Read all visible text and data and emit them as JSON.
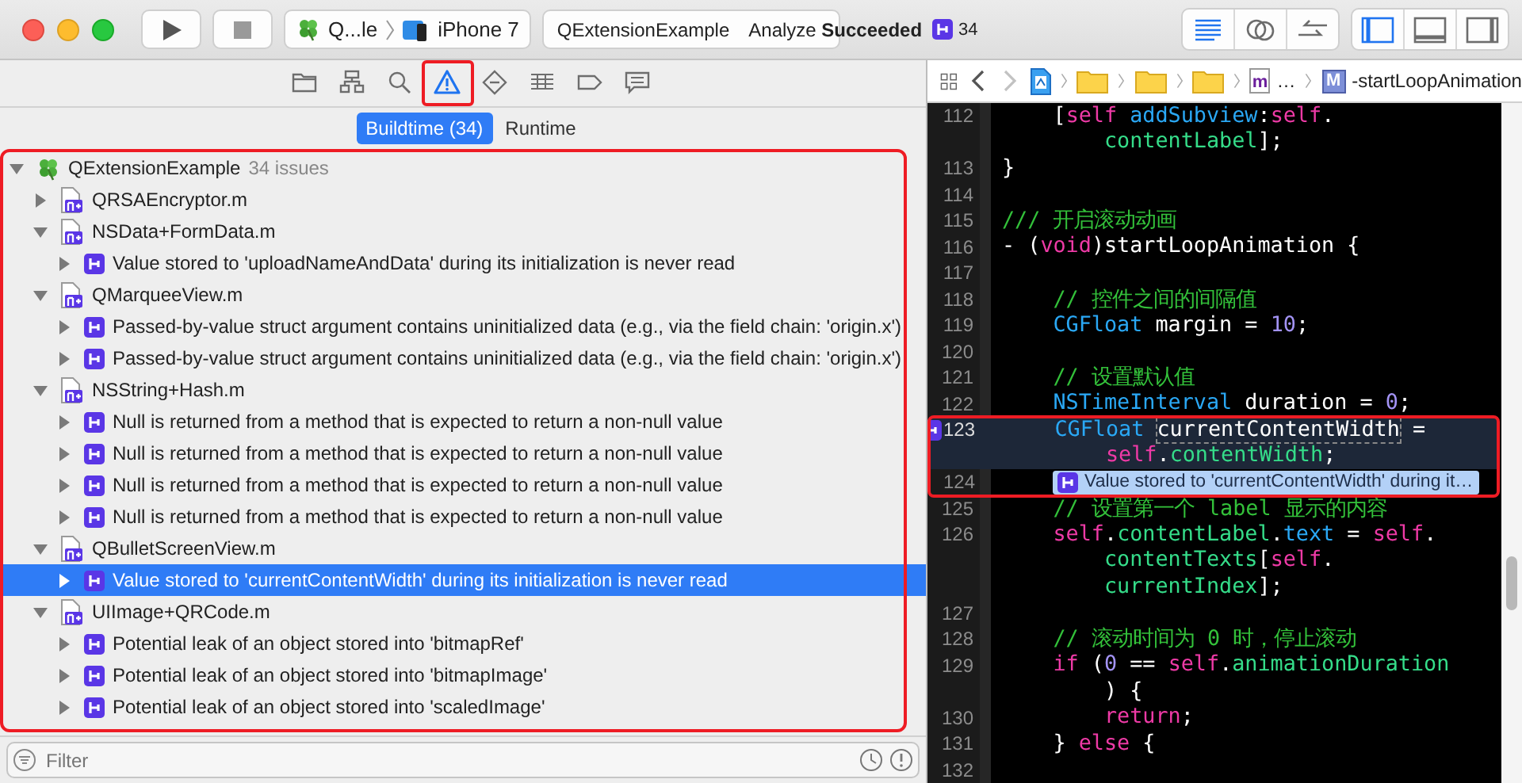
{
  "window": {
    "traffic_lights": [
      {
        "kind": "close"
      },
      {
        "kind": "minimize"
      },
      {
        "kind": "zoom"
      }
    ]
  },
  "toolbar": {
    "run_buttons": [
      {
        "kind": "run"
      },
      {
        "kind": "stop"
      }
    ],
    "scheme": {
      "project": "Q...le",
      "device": "iPhone 7"
    },
    "activity": {
      "project": "QExtensionExample",
      "status": "Analyze **Succeeded**",
      "issue_count": "34"
    },
    "editor_modes": [
      {
        "kind": "standard",
        "selected": true
      },
      {
        "kind": "assistant",
        "selected": false
      },
      {
        "kind": "version",
        "selected": false
      }
    ],
    "panels": [
      {
        "kind": "navigator",
        "on": true
      },
      {
        "kind": "debug",
        "on": false
      },
      {
        "kind": "utilities",
        "on": false
      }
    ]
  },
  "navigator": {
    "tabs": [
      {
        "kind": "folder",
        "selected": false
      },
      {
        "kind": "hierarchy",
        "selected": false
      },
      {
        "kind": "search",
        "selected": false
      },
      {
        "kind": "warning",
        "selected": true,
        "framed": true
      },
      {
        "kind": "test",
        "selected": false
      },
      {
        "kind": "debug",
        "selected": false
      },
      {
        "kind": "breakpoint",
        "selected": false
      },
      {
        "kind": "report",
        "selected": false
      }
    ],
    "segments": [
      {
        "label": "Buildtime (34)",
        "selected": true
      },
      {
        "label": "Runtime",
        "selected": false
      }
    ],
    "issue_tree": {
      "framed": true,
      "children": [
        {
          "kind": "project",
          "label": "QExtensionExample",
          "count": "34 issues",
          "expanded": true,
          "selected": false,
          "children": [
            {
              "kind": "file",
              "label": "QRSAEncryptor.m",
              "expanded": false,
              "selected": false
            },
            {
              "kind": "file",
              "label": "NSData+FormData.m",
              "expanded": true,
              "selected": false,
              "children": [
                {
                  "kind": "issue",
                  "label": "Value stored to 'uploadNameAndData' during its initialization is never read",
                  "expanded": false,
                  "selected": false
                }
              ]
            },
            {
              "kind": "file",
              "label": "QMarqueeView.m",
              "expanded": true,
              "selected": false,
              "children": [
                {
                  "kind": "issue",
                  "label": "Passed-by-value struct argument contains uninitialized data (e.g., via the field chain: 'origin.x')",
                  "expanded": false,
                  "selected": false
                },
                {
                  "kind": "issue",
                  "label": "Passed-by-value struct argument contains uninitialized data (e.g., via the field chain: 'origin.x')",
                  "expanded": false,
                  "selected": false
                }
              ]
            },
            {
              "kind": "file",
              "label": "NSString+Hash.m",
              "expanded": true,
              "selected": false,
              "children": [
                {
                  "kind": "issue",
                  "label": "Null is returned from a method that is expected to return a non-null value",
                  "expanded": false,
                  "selected": false
                },
                {
                  "kind": "issue",
                  "label": "Null is returned from a method that is expected to return a non-null value",
                  "expanded": false,
                  "selected": false
                },
                {
                  "kind": "issue",
                  "label": "Null is returned from a method that is expected to return a non-null value",
                  "expanded": false,
                  "selected": false
                },
                {
                  "kind": "issue",
                  "label": "Null is returned from a method that is expected to return a non-null value",
                  "expanded": false,
                  "selected": false
                }
              ]
            },
            {
              "kind": "file",
              "label": "QBulletScreenView.m",
              "expanded": true,
              "selected": false,
              "children": [
                {
                  "kind": "issue",
                  "label": "Value stored to 'currentContentWidth' during its initialization is never read",
                  "expanded": false,
                  "selected": true
                }
              ]
            },
            {
              "kind": "file",
              "label": "UIImage+QRCode.m",
              "expanded": true,
              "selected": false,
              "children": [
                {
                  "kind": "issue",
                  "label": "Potential leak of an object stored into 'bitmapRef'",
                  "expanded": false,
                  "selected": false
                },
                {
                  "kind": "issue",
                  "label": "Potential leak of an object stored into 'bitmapImage'",
                  "expanded": false,
                  "selected": false
                },
                {
                  "kind": "issue",
                  "label": "Potential leak of an object stored into 'scaledImage'",
                  "expanded": false,
                  "selected": false
                }
              ]
            }
          ]
        }
      ]
    },
    "filter": {
      "placeholder": "Filter"
    }
  },
  "editor": {
    "nav_buttons": [
      {
        "kind": "back",
        "disabled": false
      },
      {
        "kind": "forward",
        "disabled": true
      }
    ],
    "breadcrumb": [
      {
        "kind": "project"
      },
      {
        "kind": "folder"
      },
      {
        "kind": "folder"
      },
      {
        "kind": "folder"
      },
      {
        "kind": "source",
        "badge": "m",
        "label": "…"
      },
      {
        "kind": "method",
        "badge": "M",
        "label": "-startLoopAnimation"
      }
    ],
    "lines": [
      {
        "number": "112",
        "segments": [
          {
            "kind": "plain",
            "text": "    ["
          },
          {
            "kind": "keyword",
            "text": "self"
          },
          {
            "kind": "type",
            "text": " addSubview"
          },
          {
            "kind": "plain",
            "text": ":"
          },
          {
            "kind": "keyword",
            "text": "self"
          },
          {
            "kind": "plain",
            "text": "."
          }
        ]
      },
      {
        "segments": [
          {
            "kind": "ident",
            "text": "        contentLabel"
          },
          {
            "kind": "plain",
            "text": "];"
          }
        ]
      },
      {
        "number": "113",
        "segments": [
          {
            "kind": "plain",
            "text": "}"
          }
        ]
      },
      {
        "number": "114"
      },
      {
        "number": "115",
        "segments": [
          {
            "kind": "comment",
            "text": "/// 开启滚动动画"
          }
        ]
      },
      {
        "number": "116",
        "segments": [
          {
            "kind": "plain",
            "text": "- ("
          },
          {
            "kind": "keyword",
            "text": "void"
          },
          {
            "kind": "plain",
            "text": ")startLoopAnimation {"
          }
        ]
      },
      {
        "number": "117"
      },
      {
        "number": "118",
        "segments": [
          {
            "kind": "comment",
            "text": "    // 控件之间的间隔值"
          }
        ]
      },
      {
        "number": "119",
        "segments": [
          {
            "kind": "type",
            "text": "    CGFloat"
          },
          {
            "kind": "plain",
            "text": " margin = "
          },
          {
            "kind": "number",
            "text": "10"
          },
          {
            "kind": "plain",
            "text": ";"
          }
        ]
      },
      {
        "number": "120"
      },
      {
        "number": "121",
        "segments": [
          {
            "kind": "comment",
            "text": "    // 设置默认值"
          }
        ]
      },
      {
        "number": "122",
        "segments": [
          {
            "kind": "type",
            "text": "    NSTimeInterval"
          },
          {
            "kind": "plain",
            "text": " duration = "
          },
          {
            "kind": "number",
            "text": "0"
          },
          {
            "kind": "plain",
            "text": ";"
          }
        ]
      },
      {
        "number": "123",
        "issue": true,
        "highlighted": true,
        "framed": true,
        "segments": [
          {
            "kind": "type",
            "text": "    CGFloat "
          },
          {
            "kind": "flagged",
            "text": "currentContentWidth"
          },
          {
            "kind": "plain",
            "text": " ="
          }
        ]
      },
      {
        "highlighted": true,
        "framed": true,
        "segments": [
          {
            "kind": "keyword",
            "text": "        self"
          },
          {
            "kind": "plain",
            "text": "."
          },
          {
            "kind": "ident",
            "text": "contentWidth"
          },
          {
            "kind": "plain",
            "text": ";"
          }
        ]
      },
      {
        "number": "124",
        "framed": true,
        "annotation": "Value stored to 'currentContentWidth' during it…"
      },
      {
        "number": "125",
        "segments": [
          {
            "kind": "comment",
            "text": "    // 设置第一个 label 显示的内容"
          }
        ]
      },
      {
        "number": "126",
        "segments": [
          {
            "kind": "keyword",
            "text": "    self"
          },
          {
            "kind": "plain",
            "text": "."
          },
          {
            "kind": "ident",
            "text": "contentLabel"
          },
          {
            "kind": "plain",
            "text": "."
          },
          {
            "kind": "type",
            "text": "text"
          },
          {
            "kind": "plain",
            "text": " = "
          },
          {
            "kind": "keyword",
            "text": "self"
          },
          {
            "kind": "plain",
            "text": "."
          }
        ]
      },
      {
        "segments": [
          {
            "kind": "ident",
            "text": "        contentTexts"
          },
          {
            "kind": "plain",
            "text": "["
          },
          {
            "kind": "keyword",
            "text": "self"
          },
          {
            "kind": "plain",
            "text": "."
          }
        ]
      },
      {
        "segments": [
          {
            "kind": "ident",
            "text": "        currentIndex"
          },
          {
            "kind": "plain",
            "text": "];"
          }
        ]
      },
      {
        "number": "127"
      },
      {
        "number": "128",
        "segments": [
          {
            "kind": "comment",
            "text": "    // 滚动时间为 0 时，停止滚动"
          }
        ]
      },
      {
        "number": "129",
        "segments": [
          {
            "kind": "keyword",
            "text": "    if"
          },
          {
            "kind": "plain",
            "text": " ("
          },
          {
            "kind": "number",
            "text": "0"
          },
          {
            "kind": "plain",
            "text": " == "
          },
          {
            "kind": "keyword",
            "text": "self"
          },
          {
            "kind": "plain",
            "text": "."
          },
          {
            "kind": "ident",
            "text": "animationDuration"
          }
        ]
      },
      {
        "segments": [
          {
            "kind": "plain",
            "text": "        ) {"
          }
        ]
      },
      {
        "number": "130",
        "segments": [
          {
            "kind": "keyword",
            "text": "        return"
          },
          {
            "kind": "plain",
            "text": ";"
          }
        ]
      },
      {
        "number": "131",
        "segments": [
          {
            "kind": "plain",
            "text": "    } "
          },
          {
            "kind": "keyword",
            "text": "else"
          },
          {
            "kind": "plain",
            "text": " {"
          }
        ]
      },
      {
        "number": "132"
      }
    ]
  }
}
